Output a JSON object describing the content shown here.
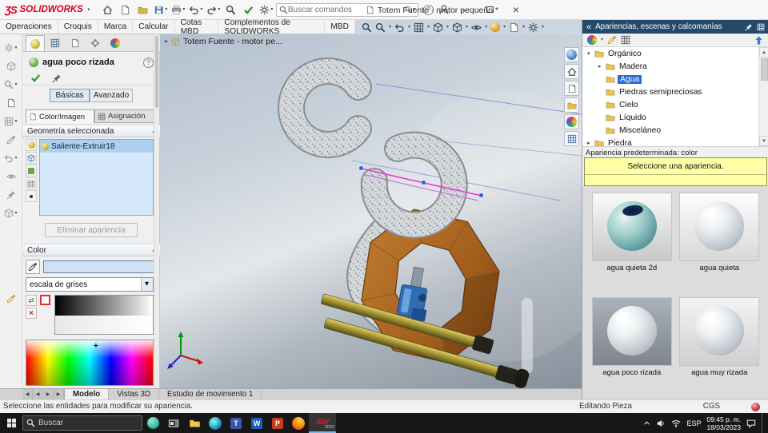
{
  "titlebar": {
    "logo_mark": "ƷS",
    "logo": "SOLIDWORKS",
    "doc_title": "Totem Fuente - motor pequeño *",
    "search_placeholder": "Buscar comandos"
  },
  "menubar": {
    "tabs": [
      "Operaciones",
      "Croquis",
      "Marca",
      "Calcular",
      "Cotas MBD",
      "Complementos de SOLIDWORKS",
      "MBD"
    ]
  },
  "property_manager": {
    "title": "agua poco rizada",
    "basic": "Básicas",
    "advanced": "Avanzado",
    "tab_color_image": "Color/Imagen",
    "tab_mapping": "Asignación",
    "geometry_header": "Geometría seleccionada",
    "geometry_item": "Saliente-Extruir18",
    "remove_button": "Eliminar apariencia",
    "color_header": "Color",
    "palette_select": "escala de grises"
  },
  "viewport": {
    "flyout_title": "Totem Fuente - motor pe..."
  },
  "task_pane": {
    "title": "Apariencias, escenas y calcomanías",
    "tree": [
      "Orgánico",
      "Madera",
      "Agua",
      "Piedras semipreciosas",
      "Cielo",
      "Líquido",
      "Misceláneo",
      "Piedra"
    ],
    "default_appearance": "Apariencia predeterminada: color",
    "hint": "Seleccione una apariencia.",
    "thumbs": [
      "agua quieta 2d",
      "agua quieta",
      "agua poco rizada",
      "agua muy rizada"
    ]
  },
  "bottom_tabs": {
    "model": "Modelo",
    "views": "Vistas 3D",
    "motion": "Estudio de movimiento 1"
  },
  "status_bar": {
    "message": "Seleccione las entidades para modificar su apariencia.",
    "editing": "Editando Pieza",
    "units": "CGS"
  },
  "taskbar": {
    "search_placeholder": "Buscar",
    "language": "ESP",
    "time": "09:45 p. m.",
    "date": "18/03/2023",
    "sw_year": "2022"
  }
}
